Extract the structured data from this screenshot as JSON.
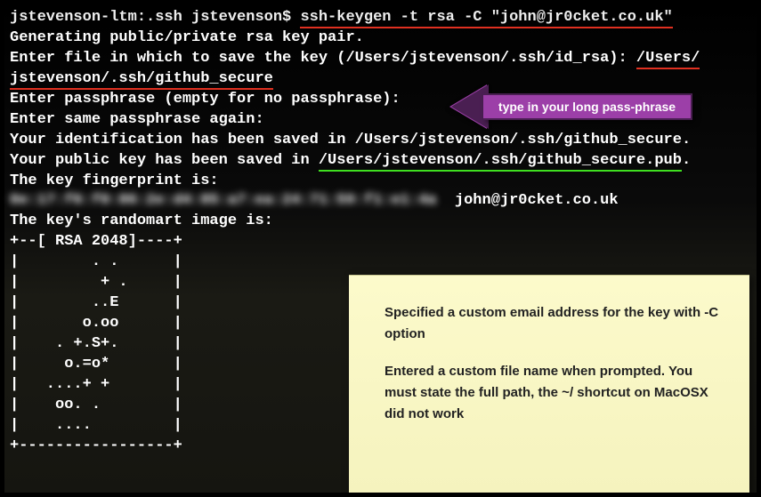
{
  "terminal": {
    "prompt": "jstevenson-ltm:.ssh jstevenson$ ",
    "command": "ssh-keygen -t rsa -C \"john@jr0cket.co.uk\"",
    "line_generating": "Generating public/private rsa key pair.",
    "line_enter_file_prefix": "Enter file in which to save the key (/Users/jstevenson/.ssh/id_rsa): ",
    "entered_path_part1": "/Users/",
    "entered_path_part2": "jstevenson/.ssh/github_secure",
    "line_passphrase": "Enter passphrase (empty for no passphrase): ",
    "line_passphrase_again": "Enter same passphrase again:",
    "line_ident_saved_prefix": "Your identification has been saved in ",
    "ident_path": "/Users/jstevenson/.ssh/github_secure",
    "line_pub_saved_prefix": "Your public key has been saved in ",
    "pub_path": "/Users/jstevenson/.ssh/github_secure.pub",
    "line_fingerprint_is": "The key fingerprint is:",
    "fingerprint_redacted": "0e:17:f6:f0:86:2e:d4:85:a7:ea:24:71:59:f1:e1:4a",
    "fingerprint_email": "  john@jr0cket.co.uk",
    "line_randomart": "The key's randomart image is:",
    "randomart": [
      "+--[ RSA 2048]----+",
      "|        . .      |",
      "|         + .     |",
      "|        ..E      |",
      "|       o.oo      |",
      "|    . +.S+.      |",
      "|     o.=o*       |",
      "|   ....+ +       |",
      "|    oo. .        |",
      "|    ....         |",
      "+-----------------+"
    ]
  },
  "annotations": {
    "arrow_text": "type in your long pass-phrase",
    "note_para1": "Specified a custom email address for the key with -C option",
    "note_para2": "Entered a custom file name when prompted.  You must state the full path, the ~/ shortcut on MacOSX did not work"
  }
}
